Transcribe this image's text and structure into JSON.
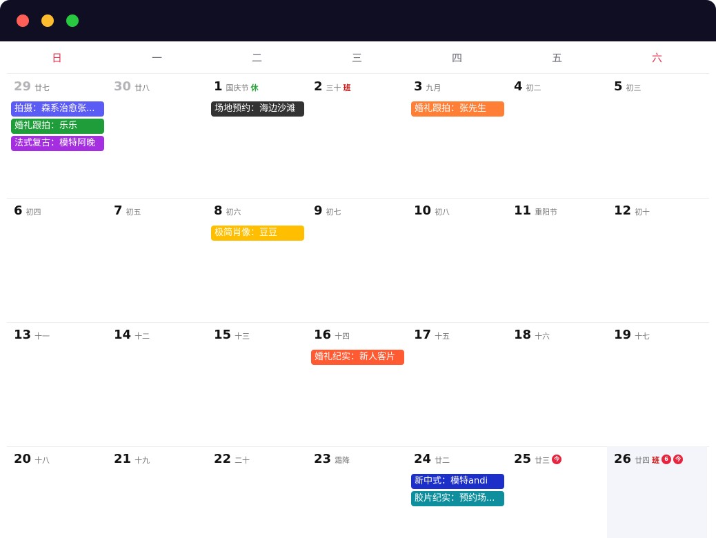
{
  "weekdays": [
    "日",
    "一",
    "二",
    "三",
    "四",
    "五",
    "六"
  ],
  "colors": {
    "titlebar": "#100e23",
    "weekend": "#e2334f",
    "rest_tag": "#27a338",
    "work_tag": "#d01818",
    "today_bg": "#f4f5fa",
    "badge": "#e8253f"
  },
  "weeks": [
    [
      {
        "num": "29",
        "lunar": "廿七",
        "other_month": true,
        "events": [
          {
            "title": "拍摄：森系治愈张...",
            "color": "#5b5bf5"
          },
          {
            "title": "婚礼跟拍：乐乐",
            "color": "#1f9d3a"
          },
          {
            "title": "法式复古：模特阿晚",
            "color": "#a42ee0"
          }
        ]
      },
      {
        "num": "30",
        "lunar": "廿八",
        "other_month": true,
        "events": []
      },
      {
        "num": "1",
        "lunar": "国庆节",
        "tag": "休",
        "tag_type": "rest",
        "events": [
          {
            "title": "场地预约：海边沙滩",
            "color": "#333333"
          }
        ]
      },
      {
        "num": "2",
        "lunar": "三十",
        "tag": "班",
        "tag_type": "work",
        "events": []
      },
      {
        "num": "3",
        "lunar": "九月",
        "events": [
          {
            "title": "婚礼跟拍：张先生",
            "color": "#ff7f36"
          }
        ]
      },
      {
        "num": "4",
        "lunar": "初二",
        "events": []
      },
      {
        "num": "5",
        "lunar": "初三",
        "events": []
      }
    ],
    [
      {
        "num": "6",
        "lunar": "初四",
        "events": []
      },
      {
        "num": "7",
        "lunar": "初五",
        "events": []
      },
      {
        "num": "8",
        "lunar": "初六",
        "events": [
          {
            "title": "极简肖像：豆豆",
            "color": "#ffbf00"
          }
        ]
      },
      {
        "num": "9",
        "lunar": "初七",
        "events": []
      },
      {
        "num": "10",
        "lunar": "初八",
        "events": []
      },
      {
        "num": "11",
        "lunar": "重阳节",
        "events": []
      },
      {
        "num": "12",
        "lunar": "初十",
        "events": []
      }
    ],
    [
      {
        "num": "13",
        "lunar": "十一",
        "events": []
      },
      {
        "num": "14",
        "lunar": "十二",
        "events": []
      },
      {
        "num": "15",
        "lunar": "十三",
        "events": []
      },
      {
        "num": "16",
        "lunar": "十四",
        "events": [
          {
            "title": "婚礼纪实：新人客片",
            "color": "#ff5a32"
          }
        ]
      },
      {
        "num": "17",
        "lunar": "十五",
        "events": []
      },
      {
        "num": "18",
        "lunar": "十六",
        "events": []
      },
      {
        "num": "19",
        "lunar": "十七",
        "events": []
      }
    ],
    [
      {
        "num": "20",
        "lunar": "十八",
        "events": []
      },
      {
        "num": "21",
        "lunar": "十九",
        "events": []
      },
      {
        "num": "22",
        "lunar": "二十",
        "events": []
      },
      {
        "num": "23",
        "lunar": "霜降",
        "events": []
      },
      {
        "num": "24",
        "lunar": "廿二",
        "events": [
          {
            "title": "新中式：模特andi",
            "color": "#1c2fc9"
          },
          {
            "title": "胶片纪实：预约场...",
            "color": "#0f8f9d"
          }
        ]
      },
      {
        "num": "25",
        "lunar": "廿三",
        "badges": [
          "今"
        ],
        "events": []
      },
      {
        "num": "26",
        "lunar": "廿四",
        "tag": "班",
        "tag_type": "work",
        "badges": [
          "6",
          "今"
        ],
        "today": true,
        "events": []
      }
    ]
  ]
}
